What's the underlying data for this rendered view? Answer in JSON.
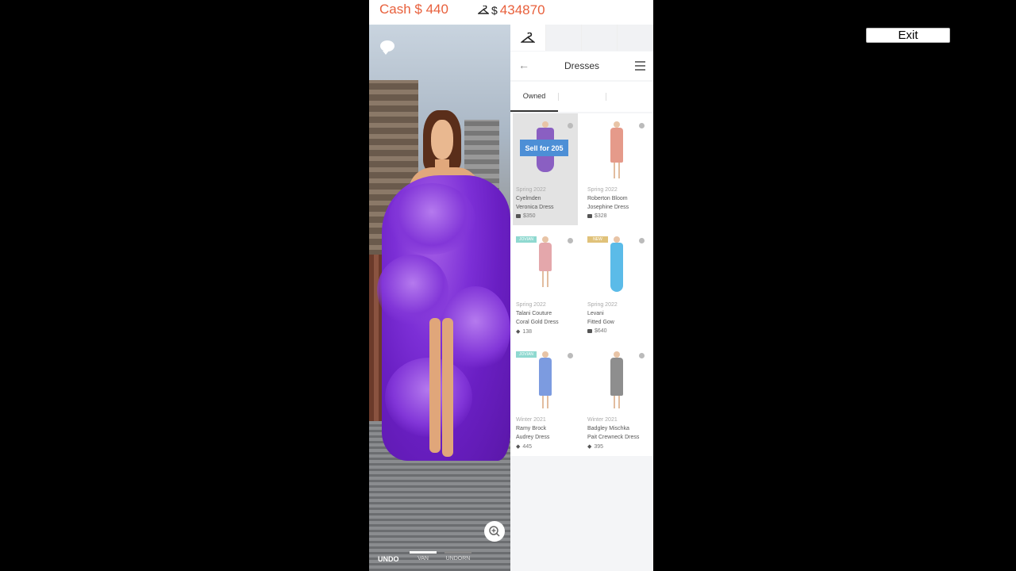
{
  "top_bar": {
    "cash_text": "Cash $ 440",
    "dollar_sign": "$",
    "coins_value": "434870"
  },
  "stage": {
    "undo_label": "UNDO",
    "controls": [
      {
        "label": "VAN",
        "bar_color": "#ffffff"
      },
      {
        "label": "UNDORN",
        "bar_color": "#888888"
      }
    ]
  },
  "panel": {
    "tabs": [
      {
        "icon": "hanger-icon",
        "active": true
      },
      {
        "icon": "",
        "active": false
      },
      {
        "icon": "",
        "active": false
      },
      {
        "icon": "",
        "active": false
      }
    ],
    "header": {
      "title": "Dresses",
      "back_icon": "arrow-left-icon",
      "filter_icon": "filter-icon"
    },
    "subtabs": [
      {
        "label": "Owned",
        "active": true
      }
    ],
    "items": [
      {
        "season": "Spring 2022",
        "brand": "Cyelmden",
        "name": "Veronica Dress",
        "price": "$350",
        "price_icon": "cash-icon",
        "dress_color": "#8a5fc2",
        "tag": "",
        "tag_color": "",
        "selected": true,
        "sell_label": "Sell for 205"
      },
      {
        "season": "Spring 2022",
        "brand": "Roberton Bloom",
        "name": "Josephine Dress",
        "price": "$328",
        "price_icon": "cash-icon",
        "dress_color": "#e59a8a",
        "tag": "",
        "tag_color": "",
        "selected": false,
        "sell_label": ""
      },
      {
        "season": "Spring 2022",
        "brand": "Talani Couture",
        "name": "Coral Gold Dress",
        "price": "138",
        "price_icon": "diamond-icon",
        "dress_color": "#e4a7ab",
        "tag": "JOVIAN",
        "tag_color": "#8fd9d0",
        "selected": false,
        "sell_label": ""
      },
      {
        "season": "Spring 2022",
        "brand": "Levani",
        "name": "Fitted Gow",
        "price": "$640",
        "price_icon": "cash-icon",
        "dress_color": "#5bbbe8",
        "tag": "NEW",
        "tag_color": "#e0c27a",
        "selected": false,
        "sell_label": ""
      },
      {
        "season": "Winter 2021",
        "brand": "Ramy Brock",
        "name": "Audrey Dress",
        "price": "445",
        "price_icon": "diamond-icon",
        "dress_color": "#7c9be0",
        "tag": "JOVIAN",
        "tag_color": "#8fd9d0",
        "selected": false,
        "sell_label": ""
      },
      {
        "season": "Winter 2021",
        "brand": "Badgley Mischka",
        "name": "Pait Crewneck Dress",
        "price": "395",
        "price_icon": "diamond-icon",
        "dress_color": "#8e8e8e",
        "tag": "",
        "tag_color": "",
        "selected": false,
        "sell_label": ""
      }
    ]
  },
  "exit_label": "Exit",
  "colors": {
    "accent": "#e8603c",
    "sell_button": "#4d8fd6",
    "dress_purple": "#7c2fd6"
  }
}
